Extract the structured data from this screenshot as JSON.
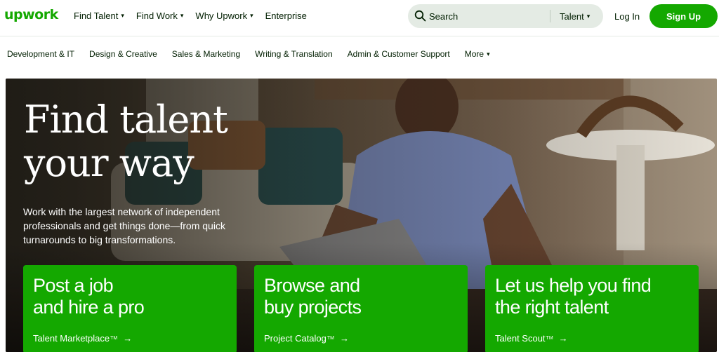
{
  "brand": {
    "logo_text": "upwork",
    "accent": "#14a800"
  },
  "nav": {
    "items": [
      {
        "label": "Find Talent",
        "has_dropdown": true
      },
      {
        "label": "Find Work",
        "has_dropdown": true
      },
      {
        "label": "Why Upwork",
        "has_dropdown": true
      },
      {
        "label": "Enterprise",
        "has_dropdown": false
      }
    ],
    "chevron": "⌄"
  },
  "search": {
    "placeholder": "Search",
    "scope": "Talent",
    "icon": "search-icon"
  },
  "auth": {
    "login": "Log In",
    "signup": "Sign Up"
  },
  "categories": {
    "items": [
      "Development & IT",
      "Design & Creative",
      "Sales & Marketing",
      "Writing & Translation",
      "Admin & Customer Support"
    ],
    "more": "More"
  },
  "hero": {
    "title_line1": "Find talent",
    "title_line2": "your way",
    "subtitle": "Work with the largest network of independent professionals and get things done—from quick turnarounds to big transformations.",
    "cards": [
      {
        "title_line1": "Post a job",
        "title_line2": "and hire a pro",
        "link": "Talent Marketplace",
        "tm": "TM",
        "arrow": "→"
      },
      {
        "title_line1": "Browse and",
        "title_line2": "buy projects",
        "link": "Project Catalog",
        "tm": "TM",
        "arrow": "→"
      },
      {
        "title_line1": "Let us help you find",
        "title_line2": "the right talent",
        "link": "Talent Scout",
        "tm": "TM",
        "arrow": "→"
      }
    ]
  }
}
